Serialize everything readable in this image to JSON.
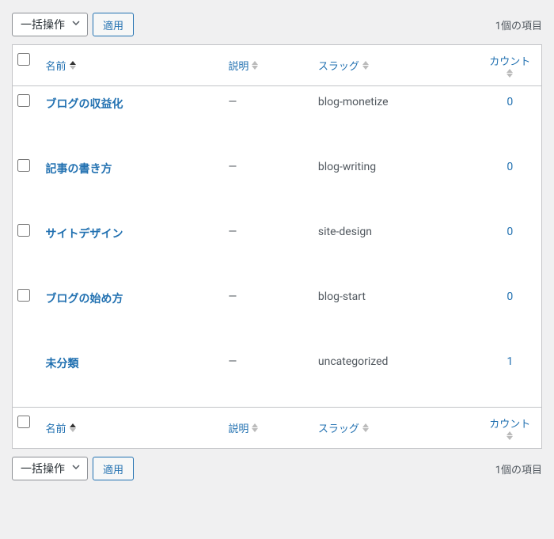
{
  "bulk": {
    "label": "一括操作",
    "apply": "適用"
  },
  "item_count": "1個の項目",
  "columns": {
    "name": "名前",
    "desc": "説明",
    "slug": "スラッグ",
    "count": "カウント"
  },
  "rows": [
    {
      "name": "ブログの収益化",
      "desc": "—",
      "slug": "blog-monetize",
      "count": "0",
      "checkbox": true
    },
    {
      "name": "記事の書き方",
      "desc": "—",
      "slug": "blog-writing",
      "count": "0",
      "checkbox": true
    },
    {
      "name": "サイトデザイン",
      "desc": "—",
      "slug": "site-design",
      "count": "0",
      "checkbox": true
    },
    {
      "name": "ブログの始め方",
      "desc": "—",
      "slug": "blog-start",
      "count": "0",
      "checkbox": true
    },
    {
      "name": "未分類",
      "desc": "—",
      "slug": "uncategorized",
      "count": "1",
      "checkbox": false
    }
  ]
}
